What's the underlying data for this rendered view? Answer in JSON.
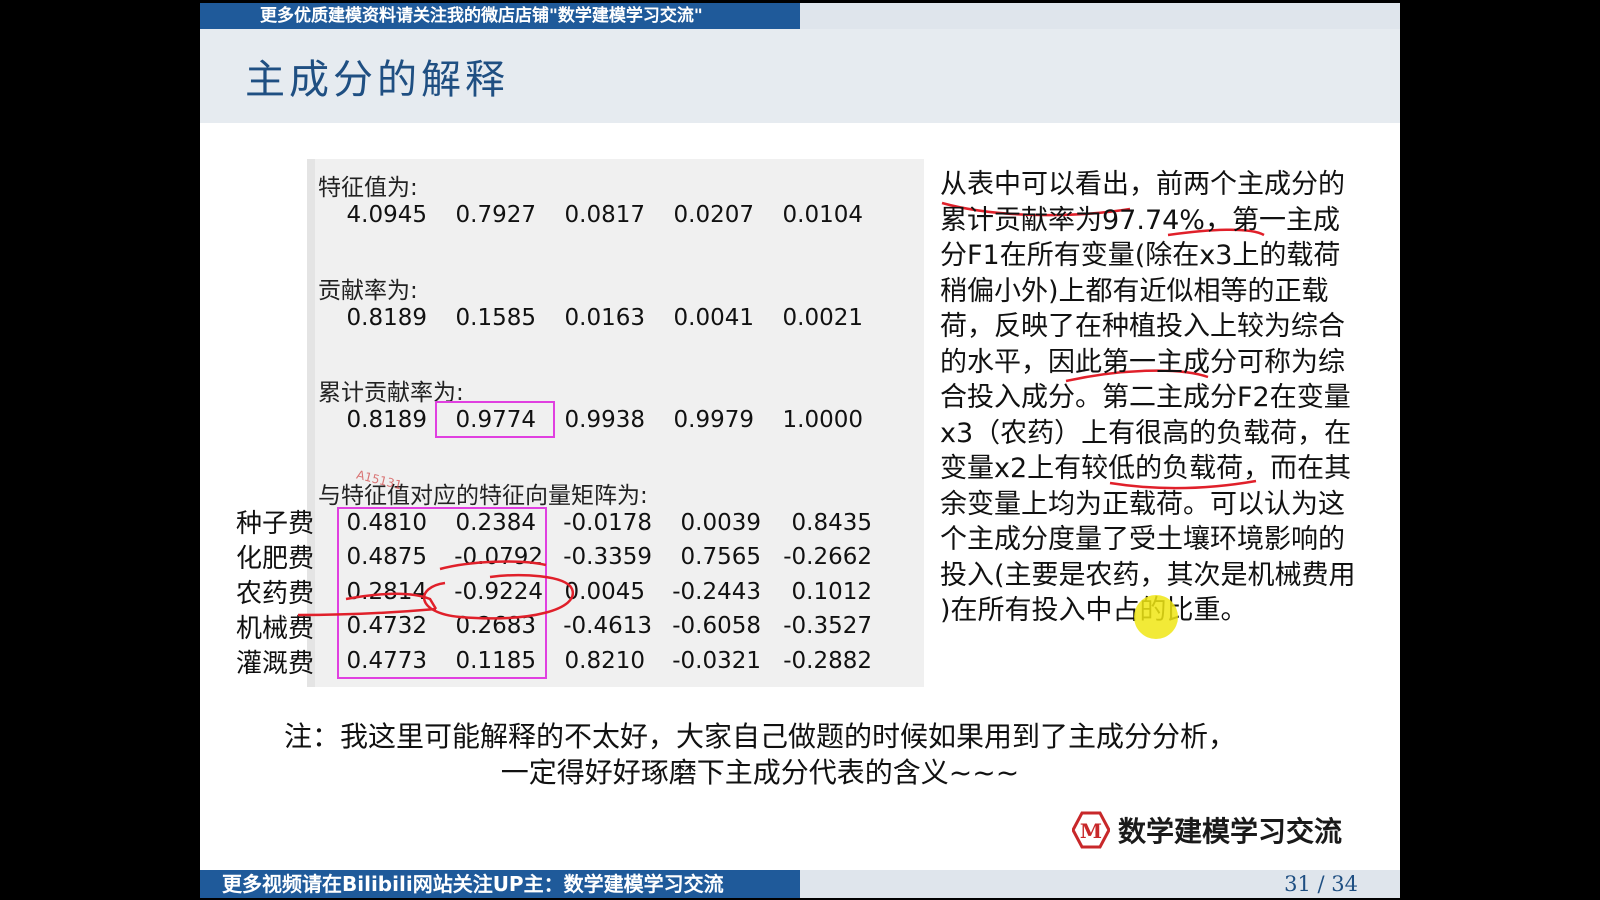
{
  "top_banner": "更多优质建模资料请关注我的微店店铺\"数学建模学习交流\"",
  "title": "主成分的解释",
  "output": {
    "eigenvalues_label": "特征值为:",
    "eigenvalues": [
      "4.0945",
      "0.7927",
      "0.0817",
      "0.0207",
      "0.0104"
    ],
    "contribution_label": "贡献率为:",
    "contribution": [
      "0.8189",
      "0.1585",
      "0.0163",
      "0.0041",
      "0.0021"
    ],
    "cumulative_label": "累计贡献率为:",
    "cumulative": [
      "0.8189",
      "0.9774",
      "0.9938",
      "0.9979",
      "1.0000"
    ],
    "matrix_label": "与特征值对应的特征向量矩阵为:",
    "rows": [
      {
        "name": "种子费",
        "values": [
          "0.4810",
          "0.2384",
          "-0.0178",
          "0.0039",
          "0.8435"
        ]
      },
      {
        "name": "化肥费",
        "values": [
          "0.4875",
          "-0.0792",
          "-0.3359",
          "0.7565",
          "-0.2662"
        ]
      },
      {
        "name": "农药费",
        "values": [
          "0.2814",
          "-0.9224",
          "0.0045",
          "-0.2443",
          "0.1012"
        ]
      },
      {
        "name": "机械费",
        "values": [
          "0.4732",
          "0.2683",
          "-0.4613",
          "-0.6058",
          "-0.3527"
        ]
      },
      {
        "name": "灌溉费",
        "values": [
          "0.4773",
          "0.1185",
          "0.8210",
          "-0.0321",
          "-0.2882"
        ]
      }
    ]
  },
  "explanation": "从表中可以看出，前两个主成分的累计贡献率为97.74%，第一主成分F1在所有变量(除在x3上的载荷稍偏小外)上都有近似相等的正载荷，反映了在种植投入上较为综合的水平，因此第一主成分可称为综合投入成分。第二主成分F2在变量x3（农药）上有很高的负载荷，在变量x2上有较低的负载荷，而在其余变量上均为正载荷。可以认为这个主成分度量了受土壤环境影响的投入(主要是农药，其次是机械费用 )在所有投入中占的比重。",
  "note_line1": "注：我这里可能解释的不太好，大家自己做题的时候如果用到了主成分分析，",
  "note_line2": "一定得好好琢磨下主成分代表的含义~~~",
  "logo_text": "数学建模学习交流",
  "bottom_banner": "更多视频请在Bilibili网站关注UP主：数学建模学习交流",
  "page_number": "31 / 34",
  "watermark": "A15131",
  "colors": {
    "banner": "#1f5a9a",
    "title": "#1f4f82",
    "box": "#e040e0",
    "ink": "#e0202a"
  }
}
